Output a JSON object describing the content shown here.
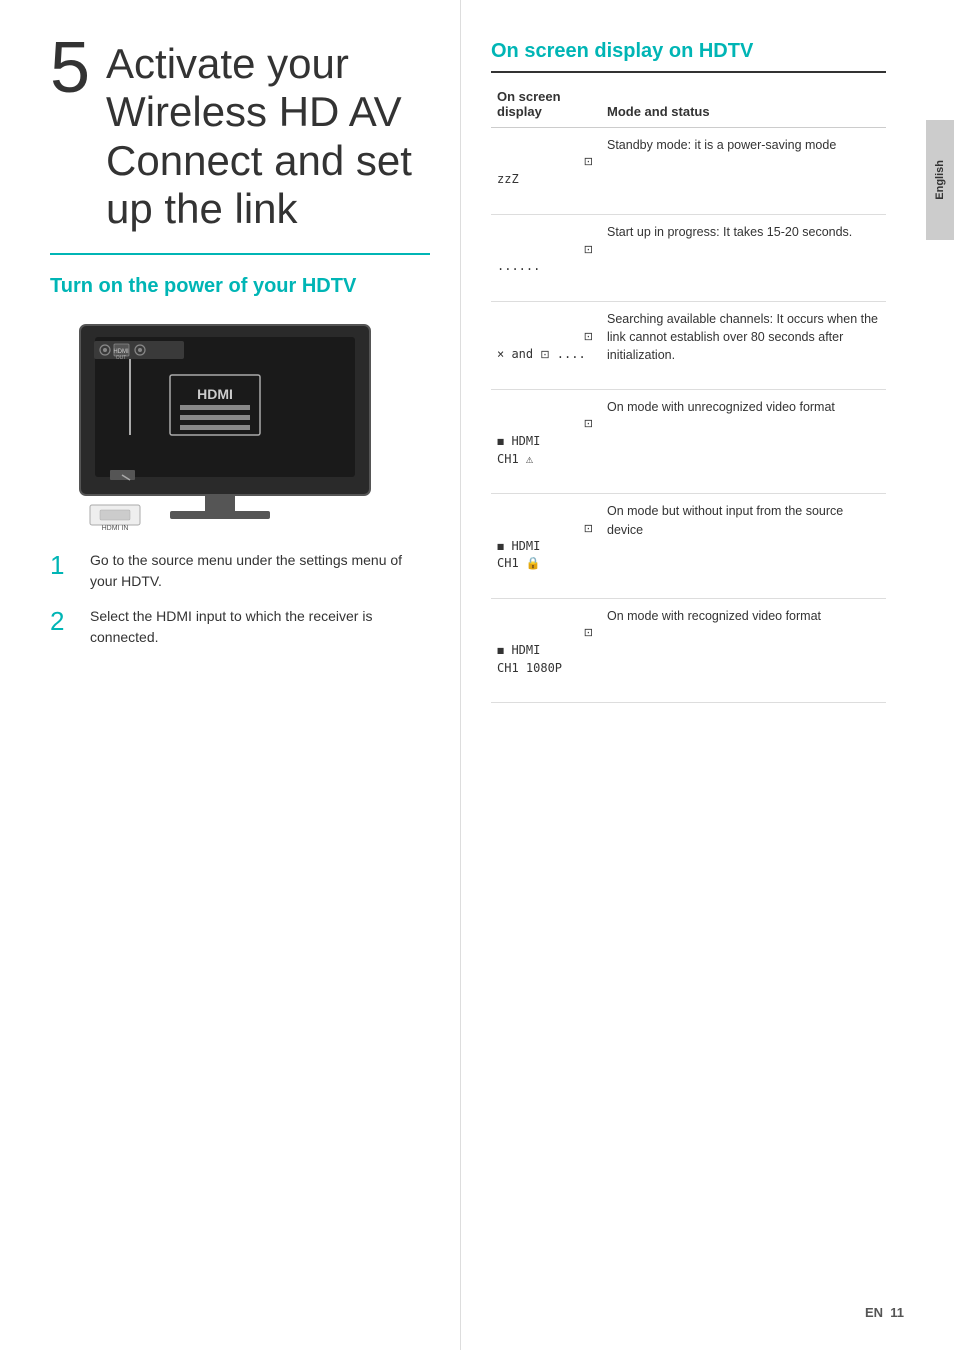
{
  "step": {
    "number": "5",
    "title_line1": "Activate your",
    "title_line2": "Wireless HD AV",
    "title_line3": "Connect and set",
    "title_line4": "up the link"
  },
  "left": {
    "subtitle": "Turn on the power of your HDTV",
    "instructions": [
      {
        "num": "1",
        "text": "Go to the source menu under the settings menu of your HDTV."
      },
      {
        "num": "2",
        "text": "Select the HDMI input to which the receiver is connected."
      }
    ]
  },
  "right": {
    "title": "On screen display on HDTV",
    "table": {
      "col1_header": "On screen display",
      "col2_header": "Mode and status",
      "rows": [
        {
          "display": "⊡ zzZ",
          "status": "Standby mode: it is a power-saving mode"
        },
        {
          "display": "⊡ ......",
          "status": "Start up in progress: It takes 15-20 seconds."
        },
        {
          "display": "⊡ × and ⊡ ....",
          "status": "Searching available channels: It occurs when the link cannot establish over 80 seconds after initialization."
        },
        {
          "display": "⊡ ◼ HDMI CH1 ⚠",
          "status": "On mode with unrecognized video format"
        },
        {
          "display": "⊡ ◼ HDMI CH1 🔒",
          "status": "On mode but without input from the source device"
        },
        {
          "display": "⊡ ◼ HDMI CH1 1080P",
          "status": "On mode with recognized video format"
        }
      ]
    }
  },
  "sidebar": {
    "label": "English"
  },
  "footer": {
    "prefix": "EN",
    "page": "11"
  }
}
